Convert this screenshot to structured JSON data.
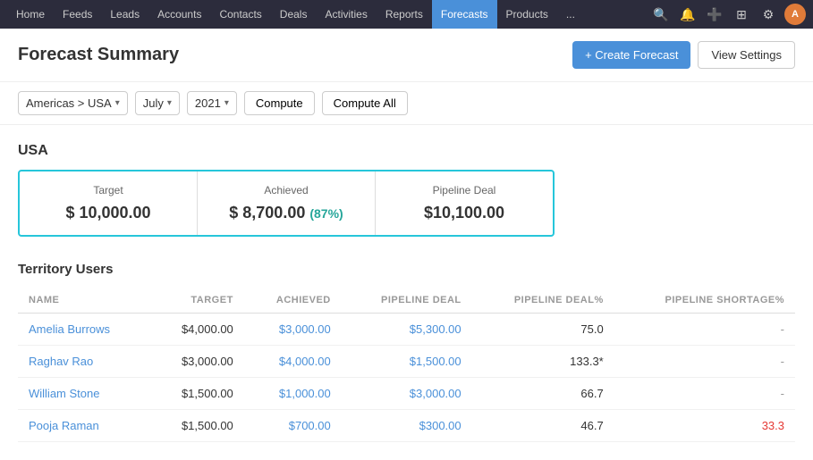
{
  "topnav": {
    "items": [
      {
        "label": "Home",
        "active": false
      },
      {
        "label": "Feeds",
        "active": false
      },
      {
        "label": "Leads",
        "active": false
      },
      {
        "label": "Accounts",
        "active": false
      },
      {
        "label": "Contacts",
        "active": false
      },
      {
        "label": "Deals",
        "active": false
      },
      {
        "label": "Activities",
        "active": false
      },
      {
        "label": "Reports",
        "active": false
      },
      {
        "label": "Forecasts",
        "active": true
      },
      {
        "label": "Products",
        "active": false
      },
      {
        "label": "...",
        "active": false
      }
    ],
    "avatar_initials": "A"
  },
  "header": {
    "title": "Forecast Summary",
    "create_btn": "+ Create Forecast",
    "settings_btn": "View Settings"
  },
  "filters": {
    "territory_value": "Americas > USA",
    "month_value": "July",
    "year_value": "2021",
    "compute_btn": "Compute",
    "compute_all_btn": "Compute All"
  },
  "summary": {
    "region": "USA",
    "metrics": [
      {
        "label": "Target",
        "value": "$ 10,000.00",
        "extra": null
      },
      {
        "label": "Achieved",
        "value": "$ 8,700.00",
        "extra": "(87%)"
      },
      {
        "label": "Pipeline Deal",
        "value": "$10,100.00",
        "extra": null
      }
    ]
  },
  "territory": {
    "title": "Territory Users",
    "columns": [
      "NAME",
      "TARGET",
      "ACHIEVED",
      "PIPELINE DEAL",
      "PIPELINE DEAL%",
      "PIPELINE SHORTAGE%"
    ],
    "rows": [
      {
        "name": "Amelia Burrows",
        "target": "$4,000.00",
        "achieved": "$3,000.00",
        "pipeline_deal": "$5,300.00",
        "pipeline_deal_pct": "75.0",
        "pipeline_shortage_pct": "-",
        "shortage_red": false
      },
      {
        "name": "Raghav Rao",
        "target": "$3,000.00",
        "achieved": "$4,000.00",
        "pipeline_deal": "$1,500.00",
        "pipeline_deal_pct": "133.3*",
        "pipeline_shortage_pct": "-",
        "shortage_red": false
      },
      {
        "name": "William Stone",
        "target": "$1,500.00",
        "achieved": "$1,000.00",
        "pipeline_deal": "$3,000.00",
        "pipeline_deal_pct": "66.7",
        "pipeline_shortage_pct": "-",
        "shortage_red": false
      },
      {
        "name": "Pooja Raman",
        "target": "$1,500.00",
        "achieved": "$700.00",
        "pipeline_deal": "$300.00",
        "pipeline_deal_pct": "46.7",
        "pipeline_shortage_pct": "33.3",
        "shortage_red": true
      }
    ]
  }
}
